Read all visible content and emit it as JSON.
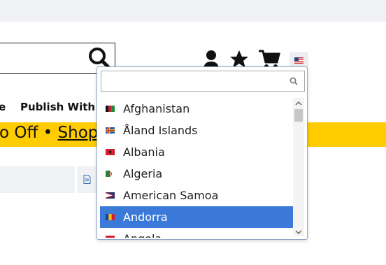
{
  "header": {
    "search_icon": "search-icon",
    "account_icon": "user-icon",
    "wishlist_icon": "star-icon",
    "cart_icon": "cart-icon",
    "flag_icon": "us-flag-icon"
  },
  "nav": {
    "partial_item": "e",
    "publish_label": "Publish With U"
  },
  "promo": {
    "text": "o Off • ",
    "link": "Shop N"
  },
  "country_dropdown": {
    "search_value": "",
    "search_placeholder": "",
    "selected": "Andorra",
    "items": [
      {
        "label": "Afghanistan",
        "flag": "af-flag-icon"
      },
      {
        "label": "Åland Islands",
        "flag": "ax-flag-icon"
      },
      {
        "label": "Albania",
        "flag": "al-flag-icon"
      },
      {
        "label": "Algeria",
        "flag": "dz-flag-icon"
      },
      {
        "label": "American Samoa",
        "flag": "as-flag-icon"
      },
      {
        "label": "Andorra",
        "flag": "ad-flag-icon"
      },
      {
        "label": "Angola",
        "flag": "ao-flag-icon"
      }
    ]
  },
  "colors": {
    "promo_bg": "#ffcc00",
    "selected_bg": "#3b7ad8",
    "topbar_bg": "#f0f1f4"
  }
}
